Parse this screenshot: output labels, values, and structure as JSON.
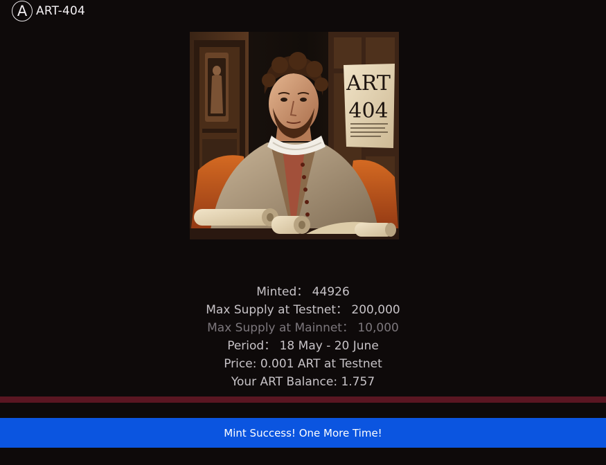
{
  "header": {
    "logo_letter": "A",
    "title": "ART-404"
  },
  "artwork": {
    "sign_line1": "ART",
    "sign_line2": "404"
  },
  "stats": {
    "minted": "Minted： 44926",
    "max_supply_testnet": "Max Supply at Testnet： 200,000",
    "max_supply_mainnet": "Max Supply at Mainnet： 10,000",
    "period": "Period： 18 May - 20 June",
    "price": "Price: 0.001 ART at Testnet",
    "balance": "Your ART Balance: 1.757"
  },
  "mint_button": {
    "label": "Mint Success! One More Time!"
  },
  "colors": {
    "background": "#0e0a0a",
    "accent": "#0b55e0",
    "divider": "#5a1622"
  }
}
